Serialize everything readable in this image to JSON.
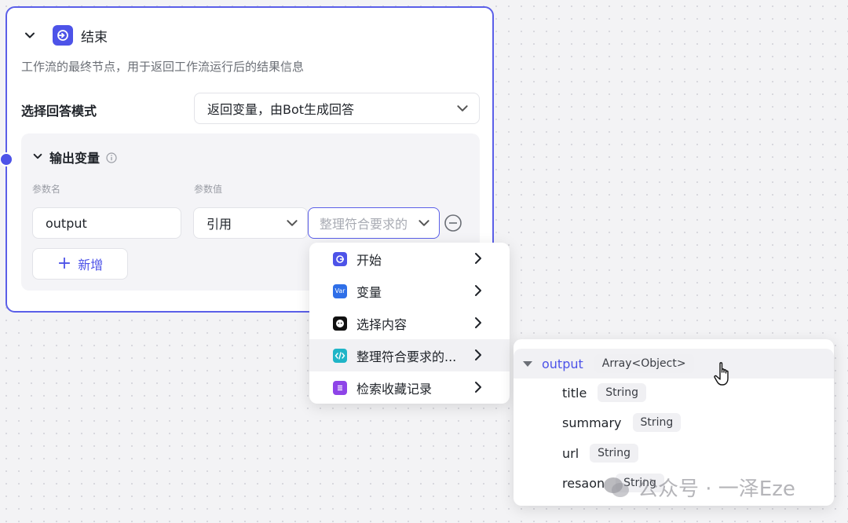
{
  "node": {
    "title": "结束",
    "description": "工作流的最终节点，用于返回工作流运行后的结果信息",
    "accent_color": "#4d53e8"
  },
  "answer_mode": {
    "label": "选择回答模式",
    "value": "返回变量，由Bot生成回答"
  },
  "output_section": {
    "title": "输出变量",
    "col_name": "参数名",
    "col_value": "参数值",
    "param_name": "output",
    "ref_type": "引用",
    "var_placeholder": "整理符合要求的",
    "add_label": "新增"
  },
  "dropdown": {
    "items": [
      {
        "label": "开始",
        "icon": "start-icon",
        "color": "#4d53e8"
      },
      {
        "label": "变量",
        "icon": "var-icon",
        "color": "#2f6fe8"
      },
      {
        "label": "选择内容",
        "icon": "bot-icon",
        "color": "#111111"
      },
      {
        "label": "整理符合要求的...",
        "icon": "code-icon",
        "color": "#1fb5c7"
      },
      {
        "label": "检索收藏记录",
        "icon": "list-icon",
        "color": "#8e44e8"
      }
    ],
    "var_icon_text": "Var"
  },
  "subpanel": {
    "root": {
      "name": "output",
      "type": "Array<Object>"
    },
    "fields": [
      {
        "name": "title",
        "type": "String"
      },
      {
        "name": "summary",
        "type": "String"
      },
      {
        "name": "url",
        "type": "String"
      },
      {
        "name": "resaon",
        "type": "String"
      }
    ]
  },
  "watermark": {
    "text": "公众号 · 一泽Eze"
  }
}
